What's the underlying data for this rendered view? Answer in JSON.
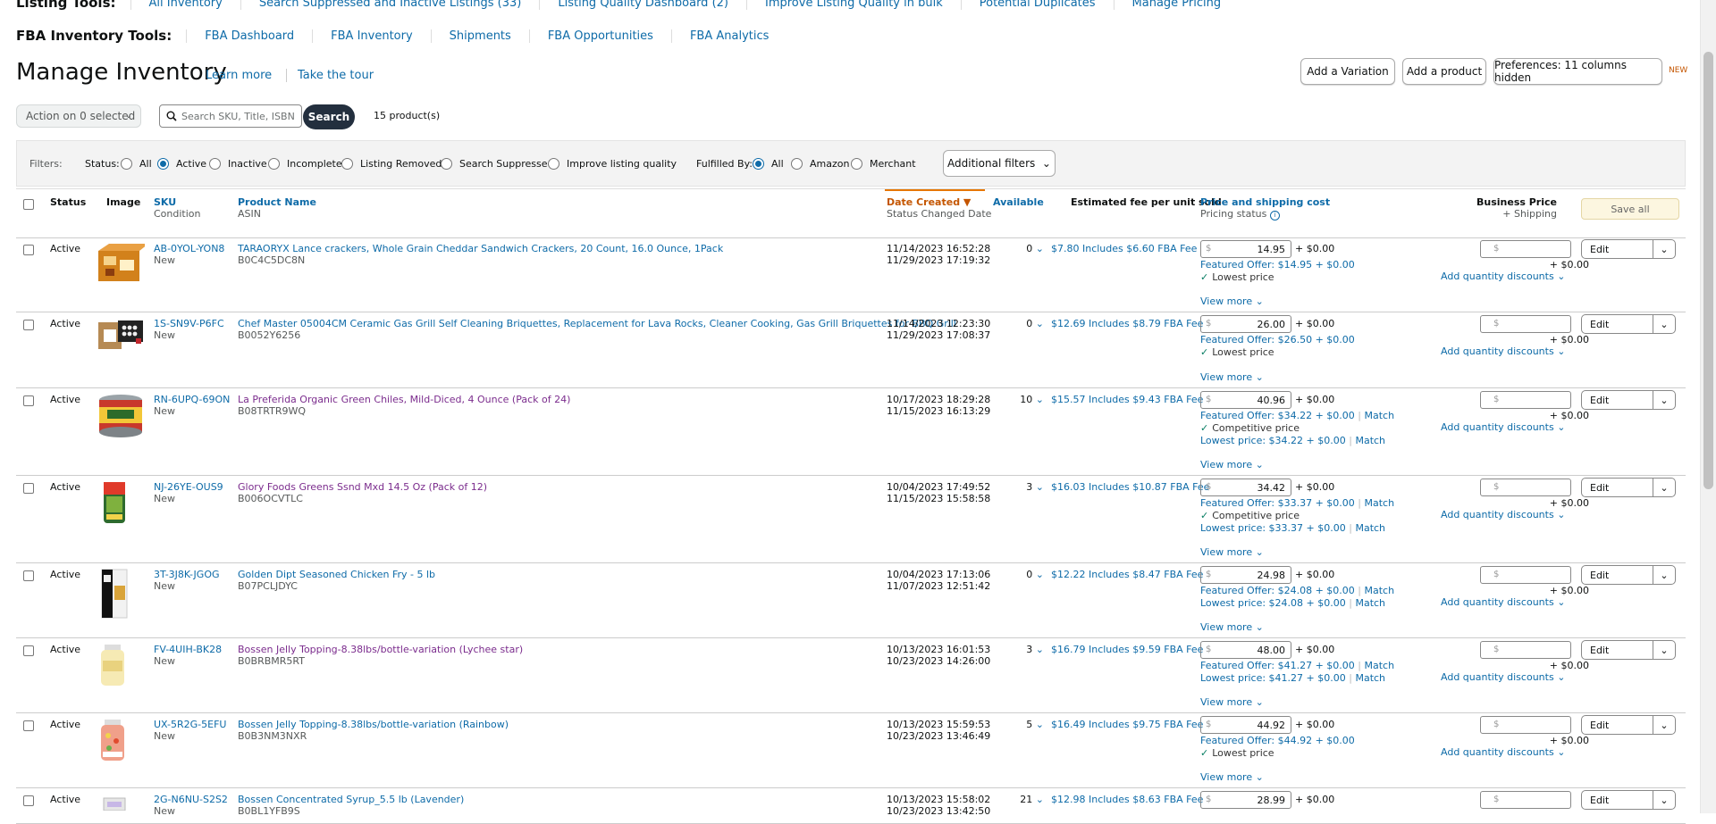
{
  "listing_tools": {
    "label": "Listing Tools:",
    "items": [
      "All Inventory",
      "Search Suppressed and Inactive Listings (33)",
      "Listing Quality Dashboard (2)",
      "Improve Listing Quality in bulk",
      "Potential Duplicates",
      "Manage Pricing"
    ]
  },
  "fba_tools": {
    "label": "FBA Inventory Tools:",
    "items": [
      "FBA Dashboard",
      "FBA Inventory",
      "Shipments",
      "FBA Opportunities",
      "FBA Analytics"
    ]
  },
  "header": {
    "title": "Manage Inventory",
    "learn_more": "Learn more",
    "tour": "Take the tour",
    "add_variation": "Add a Variation",
    "add_product": "Add a product",
    "preferences": "Preferences: 11 columns hidden",
    "new_tag": "NEW"
  },
  "toolbar": {
    "action": "Action on 0 selected",
    "search_placeholder": "Search SKU, Title, ISBN",
    "search_btn": "Search",
    "count": "15 product(s)"
  },
  "filters": {
    "label": "Filters:",
    "status_label": "Status:",
    "status_options": [
      "All",
      "Active",
      "Inactive",
      "Incomplete",
      "Listing Removed",
      "Search Suppressed",
      "Improve listing quality"
    ],
    "status_selected": "Active",
    "fulfilled_label": "Fulfilled By:",
    "fulfilled_options": [
      "All",
      "Amazon",
      "Merchant"
    ],
    "fulfilled_selected": "All",
    "additional": "Additional filters"
  },
  "columns": {
    "status": "Status",
    "image": "Image",
    "sku": "SKU",
    "condition": "Condition",
    "product_name": "Product Name",
    "asin": "ASIN",
    "date_created": "Date Created",
    "status_changed": "Status Changed Date",
    "available": "Available",
    "fee": "Estimated fee per unit sold",
    "price": "Price and shipping cost",
    "pricing_status": "Pricing status",
    "business_price": "Business Price",
    "shipping": "+ Shipping",
    "save_all": "Save all"
  },
  "labels": {
    "view_more": "View more",
    "add_qty": "Add quantity discounts",
    "edit": "Edit",
    "currency": "$",
    "plus_shipping": "+ $0.00",
    "match": "Match",
    "lowest_price_label": "Lowest price",
    "competitive_price_label": "Competitive price"
  },
  "rows": [
    {
      "status": "Active",
      "sku": "AB-0YOL-YON8",
      "condition": "New",
      "name": "TARAORYX Lance crackers, Whole Grain Cheddar Sandwich Crackers, 20 Count, 16.0 Ounce, 1Pack",
      "asin": "B0C4C5DC8N",
      "created": "11/14/2023 16:52:28",
      "changed": "11/29/2023 17:19:32",
      "available": "0",
      "fee": "$7.80 Includes $6.60 FBA Fee",
      "price": "14.95",
      "featured": "Featured Offer: $14.95 + $0.00",
      "price_status": "Lowest price",
      "lowest": ""
    },
    {
      "status": "Active",
      "sku": "1S-SN9V-P6FC",
      "condition": "New",
      "name": "Chef Master 05004CM Ceramic Gas Grill Self Cleaning Briquettes, Replacement for Lava Rocks, Cleaner Cooking, Gas Grill Briquettes for BBQ Grill",
      "asin": "B0052Y6256",
      "created": "11/14/2023 12:23:30",
      "changed": "11/29/2023 17:08:37",
      "available": "0",
      "fee": "$12.69 Includes $8.79 FBA Fee",
      "price": "26.00",
      "featured": "Featured Offer: $26.50 + $0.00",
      "price_status": "Lowest price",
      "lowest": ""
    },
    {
      "status": "Active",
      "sku": "RN-6UPQ-69ON",
      "condition": "New",
      "name": "La Preferida Organic Green Chiles, Mild-Diced, 4 Ounce (Pack of 24)",
      "asin": "B08TRTR9WQ",
      "created": "10/17/2023 18:29:28",
      "changed": "11/15/2023 16:13:29",
      "available": "10",
      "fee": "$15.57 Includes $9.43 FBA Fee",
      "price": "40.96",
      "featured": "Featured Offer: $34.22 + $0.00",
      "price_status": "Competitive price",
      "lowest": "Lowest price: $34.22 + $0.00"
    },
    {
      "status": "Active",
      "sku": "NJ-26YE-OUS9",
      "condition": "New",
      "name": "Glory Foods Greens Ssnd Mxd 14.5 Oz (Pack of 12)",
      "asin": "B006OCVTLC",
      "created": "10/04/2023 17:49:52",
      "changed": "11/15/2023 15:58:58",
      "available": "3",
      "fee": "$16.03 Includes $10.87 FBA Fee",
      "price": "34.42",
      "featured": "Featured Offer: $33.37 + $0.00",
      "price_status": "Competitive price",
      "lowest": "Lowest price: $33.37 + $0.00"
    },
    {
      "status": "Active",
      "sku": "3T-3J8K-JGOG",
      "condition": "New",
      "name": "Golden Dipt Seasoned Chicken Fry - 5 lb",
      "asin": "B07PCLJDYC",
      "created": "10/04/2023 17:13:06",
      "changed": "11/07/2023 12:51:42",
      "available": "0",
      "fee": "$12.22 Includes $8.47 FBA Fee",
      "price": "24.98",
      "featured": "Featured Offer: $24.08 + $0.00",
      "price_status": "",
      "lowest": "Lowest price: $24.08 + $0.00"
    },
    {
      "status": "Active",
      "sku": "FV-4UIH-BK28",
      "condition": "New",
      "name": "Bossen Jelly Topping-8.38lbs/bottle-variation (Lychee star)",
      "asin": "B0BRBMR5RT",
      "created": "10/13/2023 16:01:53",
      "changed": "10/23/2023 14:26:00",
      "available": "3",
      "fee": "$16.79 Includes $9.59 FBA Fee",
      "price": "48.00",
      "featured": "Featured Offer: $41.27 + $0.00",
      "price_status": "",
      "lowest": "Lowest price: $41.27 + $0.00"
    },
    {
      "status": "Active",
      "sku": "UX-5R2G-5EFU",
      "condition": "New",
      "name": "Bossen Jelly Topping-8.38lbs/bottle-variation (Rainbow)",
      "asin": "B0B3NM3NXR",
      "created": "10/13/2023 15:59:53",
      "changed": "10/23/2023 13:46:49",
      "available": "5",
      "fee": "$16.49 Includes $9.75 FBA Fee",
      "price": "44.92",
      "featured": "Featured Offer: $44.92 + $0.00",
      "price_status": "Lowest price",
      "lowest": ""
    },
    {
      "status": "Active",
      "sku": "2G-N6NU-S2S2",
      "condition": "New",
      "name": "Bossen Concentrated Syrup_5.5 lb (Lavender)",
      "asin": "B0BL1YFB9S",
      "created": "10/13/2023 15:58:02",
      "changed": "10/23/2023 13:42:50",
      "available": "21",
      "fee": "$12.98 Includes $8.63 FBA Fee",
      "price": "28.99",
      "featured": "",
      "price_status": "",
      "lowest": ""
    }
  ]
}
